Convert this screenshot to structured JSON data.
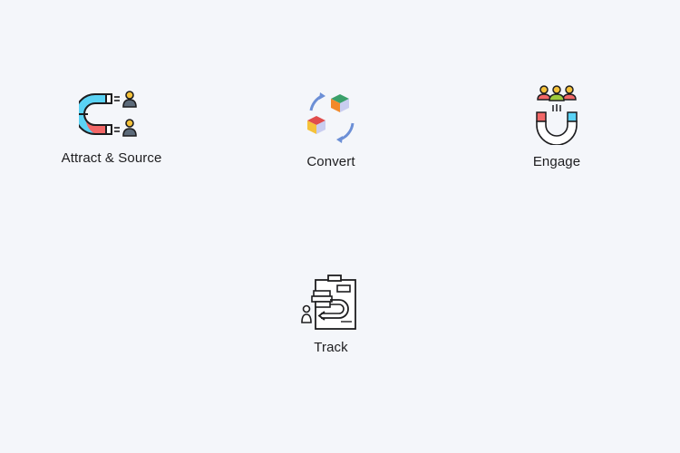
{
  "features": {
    "attract": {
      "label": "Attract & Source",
      "icon": "magnet-people-icon"
    },
    "convert": {
      "label": "Convert",
      "icon": "cubes-cycle-icon"
    },
    "engage": {
      "label": "Engage",
      "icon": "magnet-group-icon"
    },
    "track": {
      "label": "Track",
      "icon": "clipboard-funnel-icon"
    }
  },
  "colors": {
    "background": "#f4f6fa",
    "cyan": "#5bd3f5",
    "red": "#f26767",
    "green": "#3aa06a",
    "orange": "#f28a2b",
    "yellow": "#f5c23a",
    "lavender": "#c9cdf0",
    "blue_arrow": "#6c8fd6",
    "ink": "#1d1d1f"
  }
}
